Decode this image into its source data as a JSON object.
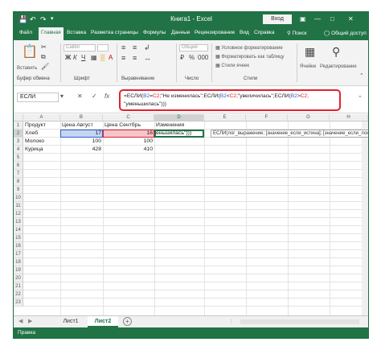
{
  "titlebar": {
    "title": "Книга1 - Excel",
    "login": "Вход",
    "save_icon": "save-icon",
    "undo_icon": "undo-icon",
    "redo_icon": "redo-icon"
  },
  "tabs": [
    "Файл",
    "Главная",
    "Вставка",
    "Разметка страницы",
    "Формулы",
    "Данные",
    "Рецензирование",
    "Вид",
    "Справка"
  ],
  "tell_me": "Поиск",
  "share": "Общий доступ",
  "ribbon": {
    "paste_label": "Вставить",
    "font_placeholder": "Calibri",
    "number_format": "Общий",
    "cond_format": "Условное форматирование",
    "format_table": "Форматировать как таблицу",
    "cell_styles": "Стили ячеек",
    "cells_label": "Ячейки",
    "edit_label": "Редактирование",
    "groups": {
      "clipboard": "Буфер обмена",
      "font": "Шрифт",
      "align": "Выравнивание",
      "number": "Число",
      "styles": "Стили"
    }
  },
  "formula_bar": {
    "name_box": "ЕСЛИ",
    "cancel": "✕",
    "enter": "✓",
    "fx": "fx",
    "line1_a": "=ЕСЛИ(",
    "line1_b2": "B2",
    "line1_eq": "=",
    "line1_c2": "C2",
    "line1_c": ";\"Не изменилась\";ЕСЛИ(",
    "line1_d": "<",
    "line1_e": ";\"увеличилась\";ЕСЛИ(",
    "line1_f": ">",
    "line1_g": ";",
    "line2": "\"уменьшилась\")))"
  },
  "columns": [
    "A",
    "B",
    "C",
    "D",
    "E",
    "F",
    "G",
    "H"
  ],
  "rows": [
    "1",
    "2",
    "3",
    "4",
    "5",
    "6",
    "7",
    "8",
    "9",
    "10",
    "11",
    "12",
    "13",
    "14",
    "15",
    "16",
    "17",
    "18",
    "19",
    "20",
    "21",
    "22",
    "23"
  ],
  "table": {
    "headers": [
      "Продукт",
      "Цена Август",
      "Цена Сентбрь",
      "Изменения"
    ],
    "rows": [
      {
        "product": "Хлеб",
        "aug": "17",
        "sep": "16",
        "change": "еньшилась\")))"
      },
      {
        "product": "Молоко",
        "aug": "100",
        "sep": "100",
        "change": ""
      },
      {
        "product": "Курица",
        "aug": "428",
        "sep": "410",
        "change": ""
      }
    ]
  },
  "tooltip": "ЕСЛИ(лог_выражение; [значение_если_истина]; [значение_если_ложь])",
  "sheets": [
    "Лист1",
    "Лист2"
  ],
  "active_sheet": "Лист2",
  "status": "Правка",
  "colors": {
    "excel_green": "#217346",
    "highlight_red": "#e4202f",
    "ref_blue": "#c5d5f2",
    "ref_red": "#f4c6c9"
  }
}
